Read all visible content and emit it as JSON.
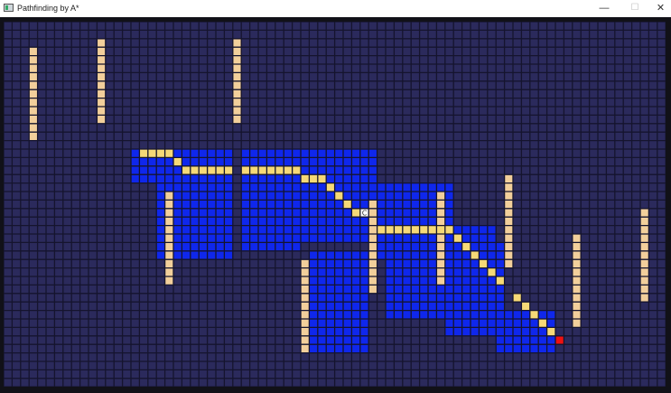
{
  "window": {
    "title": "Pathfinding by A*",
    "minimize_glyph": "—",
    "maximize_glyph": "☐",
    "close_glyph": "✕"
  },
  "colors": {
    "background": "#2b2a5c",
    "grid_line": "#15142e",
    "wall": "#f2cf9b",
    "explored": "#0f27ec",
    "path": "#f6d977",
    "goal": "#ee1111",
    "start": "#ffffff"
  },
  "grid": {
    "cols": 78,
    "rows": 43,
    "start_label": "C",
    "start": [
      42,
      22
    ],
    "goal": [
      65,
      37
    ],
    "walls": [
      [
        3,
        3,
        13
      ],
      [
        11,
        2,
        11
      ],
      [
        27,
        2,
        11
      ],
      [
        19,
        20,
        30
      ],
      [
        35,
        28,
        38
      ],
      [
        43,
        21,
        31
      ],
      [
        51,
        20,
        30
      ],
      [
        59,
        18,
        28
      ],
      [
        67,
        25,
        35
      ],
      [
        75,
        22,
        32
      ]
    ],
    "explored_regions": [
      [
        15,
        15,
        26,
        18
      ],
      [
        28,
        15,
        43,
        19
      ],
      [
        18,
        19,
        26,
        27
      ],
      [
        28,
        19,
        34,
        26
      ],
      [
        35,
        19,
        47,
        25
      ],
      [
        44,
        19,
        52,
        27
      ],
      [
        45,
        24,
        57,
        34
      ],
      [
        36,
        27,
        42,
        38
      ],
      [
        52,
        26,
        58,
        36
      ],
      [
        58,
        34,
        64,
        38
      ]
    ],
    "path": [
      [
        16,
        15
      ],
      [
        17,
        15
      ],
      [
        18,
        15
      ],
      [
        19,
        15
      ],
      [
        20,
        16
      ],
      [
        21,
        17
      ],
      [
        22,
        17
      ],
      [
        23,
        17
      ],
      [
        24,
        17
      ],
      [
        25,
        17
      ],
      [
        26,
        17
      ],
      [
        28,
        17
      ],
      [
        29,
        17
      ],
      [
        30,
        17
      ],
      [
        31,
        17
      ],
      [
        32,
        17
      ],
      [
        33,
        17
      ],
      [
        34,
        17
      ],
      [
        35,
        18
      ],
      [
        36,
        18
      ],
      [
        37,
        18
      ],
      [
        38,
        19
      ],
      [
        39,
        20
      ],
      [
        40,
        21
      ],
      [
        41,
        22
      ],
      [
        44,
        24
      ],
      [
        45,
        24
      ],
      [
        46,
        24
      ],
      [
        47,
        24
      ],
      [
        48,
        24
      ],
      [
        49,
        24
      ],
      [
        50,
        24
      ],
      [
        51,
        24
      ],
      [
        52,
        24
      ],
      [
        53,
        25
      ],
      [
        54,
        26
      ],
      [
        55,
        27
      ],
      [
        56,
        28
      ],
      [
        57,
        29
      ],
      [
        58,
        30
      ],
      [
        60,
        32
      ],
      [
        61,
        33
      ],
      [
        62,
        34
      ],
      [
        63,
        35
      ],
      [
        64,
        36
      ]
    ]
  }
}
